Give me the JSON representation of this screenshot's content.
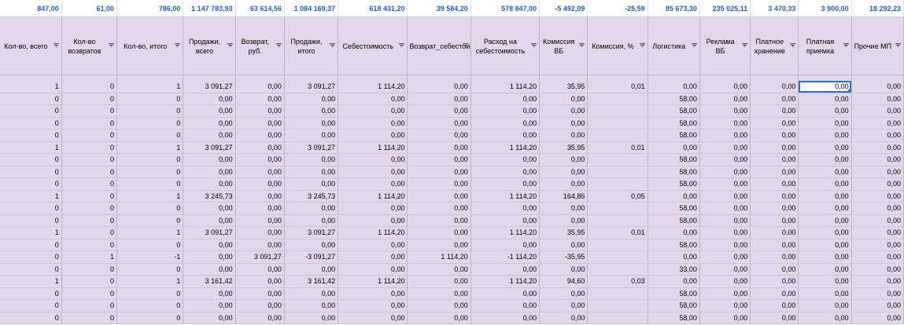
{
  "colors": {
    "totals_text": "#1f5fbf",
    "cell_fill": "#e2d8ea",
    "selection": "#2a6fd1"
  },
  "totals": [
    "847,00",
    "61,00",
    "786,00",
    "1 147 783,93",
    "63 614,56",
    "1 084 169,37",
    "618 431,20",
    "39 584,20",
    "578 847,00",
    "-5 492,09",
    "-25,59",
    "85 673,30",
    "235 025,11",
    "3 470,33",
    "3 900,00",
    "18 292,23"
  ],
  "headers": [
    "Кол-во, всего",
    "Кол-во возвратов",
    "Кол-во, итого",
    "Продажи, всего",
    "Возврат, руб.",
    "Продажи, итого",
    "Себестоимость",
    "Возврат_себестоимость",
    "Расход на себестоимость",
    "Комиссия ВБ",
    "Комиссия, %",
    "Логистика",
    "Реклама ВБ",
    "Платное хранение",
    "Платная приемка",
    "Прочие МП"
  ],
  "filter_icon": "filter-dropdown-icon",
  "rows": [
    [
      "1",
      "0",
      "1",
      "3 091,27",
      "0,00",
      "3 091,27",
      "1 114,20",
      "0,00",
      "1 114,20",
      "35,95",
      "0,01",
      "0,00",
      "0,00",
      "0,00",
      "0,00",
      "0,00"
    ],
    [
      "0",
      "0",
      "0",
      "0,00",
      "0,00",
      "0,00",
      "0,00",
      "0,00",
      "0,00",
      "0,00",
      "",
      "58,00",
      "0,00",
      "0,00",
      "0,00",
      "0,00"
    ],
    [
      "0",
      "0",
      "0",
      "0,00",
      "0,00",
      "0,00",
      "0,00",
      "0,00",
      "0,00",
      "0,00",
      "",
      "58,00",
      "0,00",
      "0,00",
      "0,00",
      "0,00"
    ],
    [
      "0",
      "0",
      "0",
      "0,00",
      "0,00",
      "0,00",
      "0,00",
      "0,00",
      "0,00",
      "0,00",
      "",
      "58,00",
      "0,00",
      "0,00",
      "0,00",
      "0,00"
    ],
    [
      "0",
      "0",
      "0",
      "0,00",
      "0,00",
      "0,00",
      "0,00",
      "0,00",
      "0,00",
      "0,00",
      "",
      "58,00",
      "0,00",
      "0,00",
      "0,00",
      "0,00"
    ],
    [
      "1",
      "0",
      "1",
      "3 091,27",
      "0,00",
      "3 091,27",
      "1 114,20",
      "0,00",
      "1 114,20",
      "35,95",
      "0,01",
      "0,00",
      "0,00",
      "0,00",
      "0,00",
      "0,00"
    ],
    [
      "0",
      "0",
      "0",
      "0,00",
      "0,00",
      "0,00",
      "0,00",
      "0,00",
      "0,00",
      "0,00",
      "",
      "58,00",
      "0,00",
      "0,00",
      "0,00",
      "0,00"
    ],
    [
      "0",
      "0",
      "0",
      "0,00",
      "0,00",
      "0,00",
      "0,00",
      "0,00",
      "0,00",
      "0,00",
      "",
      "58,00",
      "0,00",
      "0,00",
      "0,00",
      "0,00"
    ],
    [
      "0",
      "0",
      "0",
      "0,00",
      "0,00",
      "0,00",
      "0,00",
      "0,00",
      "0,00",
      "0,00",
      "",
      "58,00",
      "0,00",
      "0,00",
      "0,00",
      "0,00"
    ],
    [
      "1",
      "0",
      "1",
      "3 245,73",
      "0,00",
      "3 245,73",
      "1 114,20",
      "0,00",
      "1 114,20",
      "164,86",
      "0,05",
      "0,00",
      "0,00",
      "0,00",
      "0,00",
      "0,00"
    ],
    [
      "0",
      "0",
      "0",
      "0,00",
      "0,00",
      "0,00",
      "0,00",
      "0,00",
      "0,00",
      "0,00",
      "",
      "58,00",
      "0,00",
      "0,00",
      "0,00",
      "0,00"
    ],
    [
      "0",
      "0",
      "0",
      "0,00",
      "0,00",
      "0,00",
      "0,00",
      "0,00",
      "0,00",
      "0,00",
      "",
      "58,00",
      "0,00",
      "0,00",
      "0,00",
      "0,00"
    ],
    [
      "1",
      "0",
      "1",
      "3 091,27",
      "0,00",
      "3 091,27",
      "1 114,20",
      "0,00",
      "1 114,20",
      "35,95",
      "0,01",
      "0,00",
      "0,00",
      "0,00",
      "0,00",
      "0,00"
    ],
    [
      "0",
      "0",
      "0",
      "0,00",
      "0,00",
      "0,00",
      "0,00",
      "0,00",
      "0,00",
      "0,00",
      "",
      "58,00",
      "0,00",
      "0,00",
      "0,00",
      "0,00"
    ],
    [
      "0",
      "1",
      "-1",
      "0,00",
      "3 091,27",
      "-3 091,27",
      "0,00",
      "1 114,20",
      "-1 114,20",
      "-35,95",
      "",
      "0,00",
      "0,00",
      "0,00",
      "0,00",
      "0,00"
    ],
    [
      "0",
      "0",
      "0",
      "0,00",
      "0,00",
      "0,00",
      "0,00",
      "0,00",
      "0,00",
      "0,00",
      "",
      "33,00",
      "0,00",
      "0,00",
      "0,00",
      "0,00"
    ],
    [
      "1",
      "0",
      "1",
      "3 161,42",
      "0,00",
      "3 161,42",
      "1 114,20",
      "0,00",
      "1 114,20",
      "94,60",
      "0,03",
      "0,00",
      "0,00",
      "0,00",
      "0,00",
      "0,00"
    ],
    [
      "0",
      "0",
      "0",
      "0,00",
      "0,00",
      "0,00",
      "0,00",
      "0,00",
      "0,00",
      "0,00",
      "",
      "58,00",
      "0,00",
      "0,00",
      "0,00",
      "0,00"
    ],
    [
      "0",
      "0",
      "0",
      "0,00",
      "0,00",
      "0,00",
      "0,00",
      "0,00",
      "0,00",
      "0,00",
      "",
      "58,00",
      "0,00",
      "0,00",
      "0,00",
      "0,00"
    ],
    [
      "0",
      "0",
      "0",
      "0,00",
      "0,00",
      "0,00",
      "0,00",
      "0,00",
      "0,00",
      "0,00",
      "",
      "58,00",
      "0,00",
      "0,00",
      "0,00",
      "0,00"
    ]
  ]
}
